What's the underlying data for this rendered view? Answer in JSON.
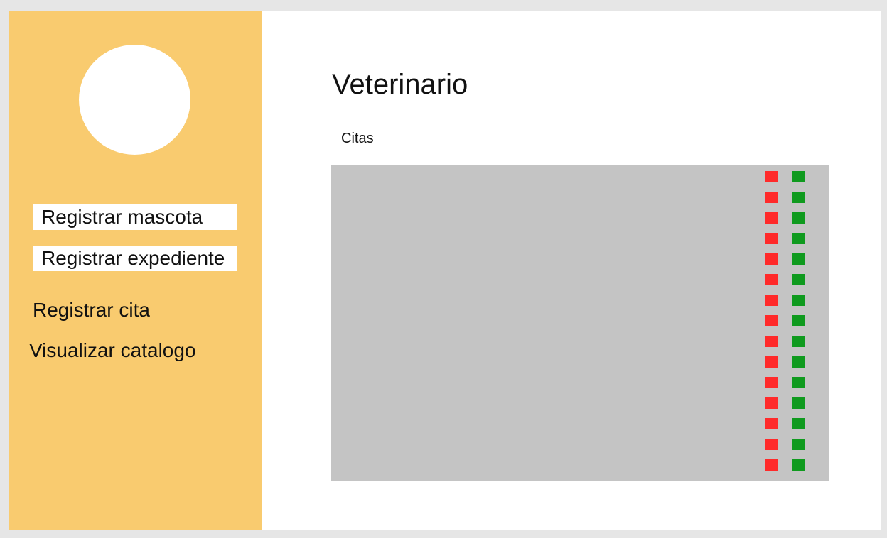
{
  "sidebar": {
    "avatar_alt": "",
    "items": [
      {
        "label": "Registrar mascota"
      },
      {
        "label": "Registrar expediente"
      },
      {
        "label": "Registrar cita"
      },
      {
        "label": "Visualizar catalogo"
      }
    ]
  },
  "main": {
    "title": "Veterinario",
    "section_label": "Citas",
    "citas_rows": 15
  },
  "colors": {
    "sidebar_bg": "#f9cb6f",
    "panel_bg": "#c4c4c4",
    "reject_marker": "#ff2a2a",
    "accept_marker": "#0f9a1e"
  }
}
